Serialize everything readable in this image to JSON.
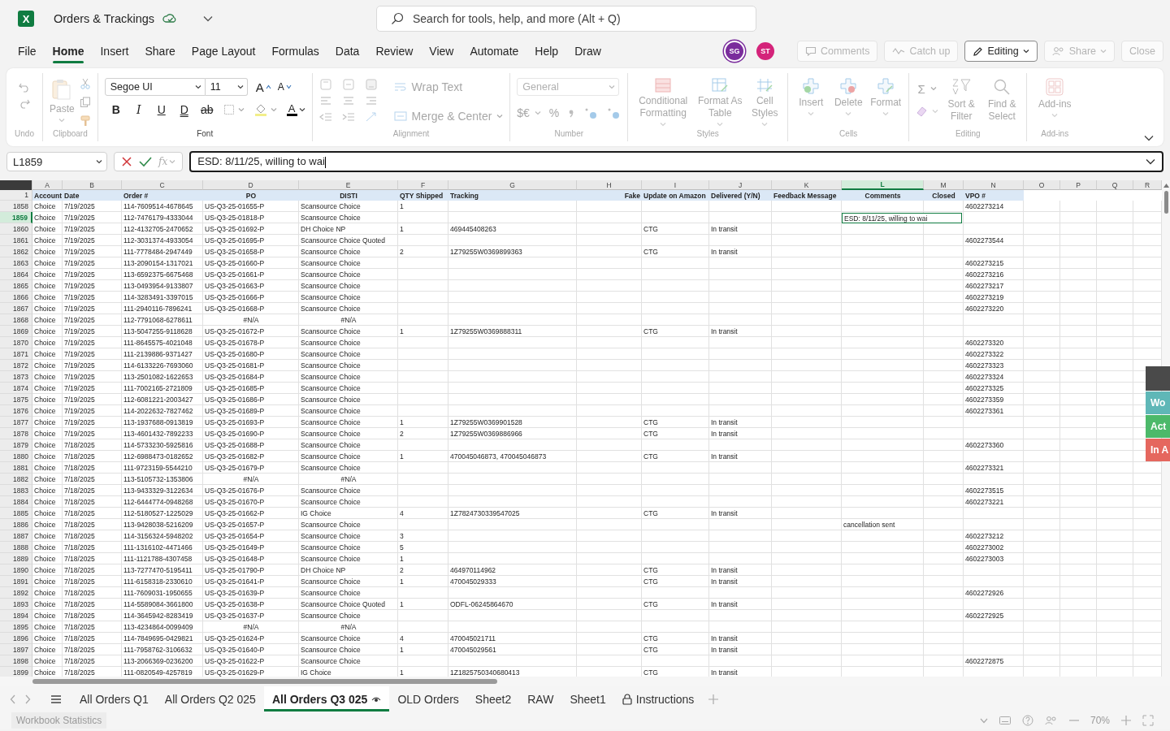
{
  "app_bar": {
    "logo_letter": "X",
    "title": "Orders & Trackings",
    "search": {
      "placeholder": "Search for tools, help, and more (Alt + Q)"
    }
  },
  "menu_tabs": [
    {
      "label": "File",
      "selected": false
    },
    {
      "label": "Home",
      "selected": true
    },
    {
      "label": "Insert",
      "selected": false
    },
    {
      "label": "Share",
      "selected": false
    },
    {
      "label": "Page Layout",
      "selected": false
    },
    {
      "label": "Formulas",
      "selected": false
    },
    {
      "label": "Data",
      "selected": false
    },
    {
      "label": "Review",
      "selected": false
    },
    {
      "label": "View",
      "selected": false
    },
    {
      "label": "Automate",
      "selected": false
    },
    {
      "label": "Help",
      "selected": false
    },
    {
      "label": "Draw",
      "selected": false
    }
  ],
  "avatars": [
    {
      "initials": "SG",
      "color": "#7a2c9c"
    },
    {
      "initials": "ST",
      "color": "#d4237a"
    }
  ],
  "header_buttons": [
    {
      "kind": "comments",
      "label": "Comments",
      "disabled": true
    },
    {
      "kind": "catchup",
      "label": "Catch up",
      "disabled": true
    },
    {
      "kind": "editing",
      "label": "Editing",
      "disabled": false
    },
    {
      "kind": "share",
      "label": "Share",
      "disabled": true
    },
    {
      "kind": "close",
      "label": "Close",
      "disabled": true
    }
  ],
  "ribbon": {
    "groups": [
      {
        "kind": "undo",
        "label": "Undo",
        "disabled": true
      },
      {
        "kind": "clipboard",
        "label": "Clipboard",
        "disabled": true,
        "paste_label": "Paste"
      },
      {
        "kind": "font",
        "label": "Font",
        "disabled": false,
        "font_name": "Segoe UI",
        "font_size": "11",
        "grow_label": "A",
        "shrink_label": "A",
        "style_buttons": [
          {
            "kind": "bold",
            "label": "B"
          },
          {
            "kind": "italic",
            "label": "I"
          },
          {
            "kind": "underline",
            "label": "U"
          },
          {
            "kind": "double",
            "label": "D"
          },
          {
            "kind": "strike",
            "label": "ab"
          }
        ],
        "font_color_label": "A"
      },
      {
        "kind": "alignment",
        "label": "Alignment",
        "disabled": true,
        "wrap_label": "Wrap Text",
        "merge_label": "Merge & Center"
      },
      {
        "kind": "number",
        "label": "Number",
        "disabled": true,
        "format": "General",
        "currency_label": "$€",
        "percent_label": "%"
      },
      {
        "kind": "styles",
        "label": "Styles",
        "disabled": true,
        "buttons": [
          "Conditional Formatting",
          "Format As Table",
          "Cell Styles"
        ]
      },
      {
        "kind": "cells",
        "label": "Cells",
        "disabled": true,
        "buttons": [
          "Insert",
          "Delete",
          "Format"
        ]
      },
      {
        "kind": "editing",
        "label": "Editing",
        "disabled": true,
        "sum_label": "Σ",
        "buttons": [
          "Sort & Filter",
          "Find & Select"
        ]
      },
      {
        "kind": "addins",
        "label": "Add-ins",
        "disabled": true,
        "buttons": [
          "Add-ins"
        ]
      }
    ]
  },
  "formula_bar": {
    "name_box": "L1859",
    "fx_label": "fx",
    "value": "ESD: 8/11/25, willing to wai"
  },
  "sheet": {
    "header_row_label": "1",
    "columns": [
      {
        "letter": "A",
        "heading": "Account",
        "selected": false
      },
      {
        "letter": "B",
        "heading": "Date",
        "selected": false
      },
      {
        "letter": "C",
        "heading": "Order #",
        "selected": false
      },
      {
        "letter": "D",
        "heading": "PO",
        "selected": false
      },
      {
        "letter": "E",
        "heading": "DISTI",
        "selected": false
      },
      {
        "letter": "F",
        "heading": "QTY Shipped",
        "selected": false
      },
      {
        "letter": "G",
        "heading": "Tracking",
        "selected": false
      },
      {
        "letter": "H",
        "heading": "Fake",
        "selected": false
      },
      {
        "letter": "I",
        "heading": "Update on Amazon",
        "selected": false
      },
      {
        "letter": "J",
        "heading": "Delivered (Y/N)",
        "selected": false
      },
      {
        "letter": "K",
        "heading": "Feedback Message",
        "selected": false
      },
      {
        "letter": "L",
        "heading": "Comments",
        "selected": true
      },
      {
        "letter": "M",
        "heading": "Closed",
        "selected": false
      },
      {
        "letter": "N",
        "heading": "VPO #",
        "selected": false
      },
      {
        "letter": "O",
        "selected": false
      },
      {
        "letter": "P",
        "selected": false
      },
      {
        "letter": "Q",
        "selected": false
      },
      {
        "letter": "R",
        "selected": false
      }
    ],
    "rows": [
      {
        "row": "1858",
        "selected": false,
        "account": "Choice",
        "date": "7/19/2025",
        "order": "114-7609514-4678645",
        "po": "US-Q3-25-01655-P",
        "disti": "Scansource Choice",
        "qty": "1",
        "vpo": "4602273214"
      },
      {
        "row": "1859",
        "selected": true,
        "account": "Choice",
        "date": "7/19/2025",
        "order": "112-7476179-4333044",
        "po": "US-Q3-25-01818-P",
        "disti": "Scansource Choice",
        "comments": "ESD: 8/11/25, willing to wai"
      },
      {
        "row": "1860",
        "selected": false,
        "account": "Choice",
        "date": "7/19/2025",
        "order": "112-4132705-2470652",
        "po": "US-Q3-25-01692-P",
        "disti": "DH Choice NP",
        "qty": "1",
        "tracking": "469445408263",
        "update": "CTG",
        "delivered": "In transit"
      },
      {
        "row": "1861",
        "selected": false,
        "account": "Choice",
        "date": "7/19/2025",
        "order": "112-3031374-4933054",
        "po": "US-Q3-25-01695-P",
        "disti": "Scansource Choice Quoted",
        "vpo": "4602273544"
      },
      {
        "row": "1862",
        "selected": false,
        "account": "Choice",
        "date": "7/19/2025",
        "order": "111-7778484-2947449",
        "po": "US-Q3-25-01658-P",
        "disti": "Scansource Choice",
        "qty": "2",
        "tracking": "1Z79255W0369899363",
        "update": "CTG",
        "delivered": "In transit"
      },
      {
        "row": "1863",
        "selected": false,
        "account": "Choice",
        "date": "7/19/2025",
        "order": "113-2090154-1317021",
        "po": "US-Q3-25-01660-P",
        "disti": "Scansource Choice",
        "vpo": "4602273215"
      },
      {
        "row": "1864",
        "selected": false,
        "account": "Choice",
        "date": "7/19/2025",
        "order": "113-6592375-6675468",
        "po": "US-Q3-25-01661-P",
        "disti": "Scansource Choice",
        "vpo": "4602273216"
      },
      {
        "row": "1865",
        "selected": false,
        "account": "Choice",
        "date": "7/19/2025",
        "order": "113-0493954-9133807",
        "po": "US-Q3-25-01663-P",
        "disti": "Scansource Choice",
        "vpo": "4602273217"
      },
      {
        "row": "1866",
        "selected": false,
        "account": "Choice",
        "date": "7/19/2025",
        "order": "114-3283491-3397015",
        "po": "US-Q3-25-01666-P",
        "disti": "Scansource Choice",
        "vpo": "4602273219"
      },
      {
        "row": "1867",
        "selected": false,
        "account": "Choice",
        "date": "7/19/2025",
        "order": "111-2940116-7896241",
        "po": "US-Q3-25-01668-P",
        "disti": "Scansource Choice",
        "vpo": "4602273220"
      },
      {
        "row": "1868",
        "selected": false,
        "account": "Choice",
        "date": "7/19/2025",
        "order": "112-7791068-6278611",
        "po": "#N/A",
        "disti": "#N/A"
      },
      {
        "row": "1869",
        "selected": false,
        "account": "Choice",
        "date": "7/19/2025",
        "order": "113-5047255-9118628",
        "po": "US-Q3-25-01672-P",
        "disti": "Scansource Choice",
        "qty": "1",
        "tracking": "1Z79255W0369888311",
        "update": "CTG",
        "delivered": "In transit"
      },
      {
        "row": "1870",
        "selected": false,
        "account": "Choice",
        "date": "7/19/2025",
        "order": "111-8645575-4021048",
        "po": "US-Q3-25-01678-P",
        "disti": "Scansource Choice",
        "vpo": "4602273320"
      },
      {
        "row": "1871",
        "selected": false,
        "account": "Choice",
        "date": "7/19/2025",
        "order": "111-2139886-9371427",
        "po": "US-Q3-25-01680-P",
        "disti": "Scansource Choice",
        "vpo": "4602273322"
      },
      {
        "row": "1872",
        "selected": false,
        "account": "Choice",
        "date": "7/19/2025",
        "order": "114-6133226-7693060",
        "po": "US-Q3-25-01681-P",
        "disti": "Scansource Choice",
        "vpo": "4602273323"
      },
      {
        "row": "1873",
        "selected": false,
        "account": "Choice",
        "date": "7/19/2025",
        "order": "113-2501082-1622653",
        "po": "US-Q3-25-01684-P",
        "disti": "Scansource Choice",
        "vpo": "4602273324"
      },
      {
        "row": "1874",
        "selected": false,
        "account": "Choice",
        "date": "7/19/2025",
        "order": "111-7002165-2721809",
        "po": "US-Q3-25-01685-P",
        "disti": "Scansource Choice",
        "vpo": "4602273325"
      },
      {
        "row": "1875",
        "selected": false,
        "account": "Choice",
        "date": "7/19/2025",
        "order": "112-6081221-2003427",
        "po": "US-Q3-25-01686-P",
        "disti": "Scansource Choice",
        "vpo": "4602273359"
      },
      {
        "row": "1876",
        "selected": false,
        "account": "Choice",
        "date": "7/19/2025",
        "order": "114-2022632-7827462",
        "po": "US-Q3-25-01689-P",
        "disti": "Scansource Choice",
        "vpo": "4602273361"
      },
      {
        "row": "1877",
        "selected": false,
        "account": "Choice",
        "date": "7/19/2025",
        "order": "113-1937688-0913819",
        "po": "US-Q3-25-01693-P",
        "disti": "Scansource Choice",
        "qty": "1",
        "tracking": "1Z79255W0369901528",
        "update": "CTG",
        "delivered": "In transit"
      },
      {
        "row": "1878",
        "selected": false,
        "account": "Choice",
        "date": "7/19/2025",
        "order": "113-4601432-7892233",
        "po": "US-Q3-25-01690-P",
        "disti": "Scansource Choice",
        "qty": "2",
        "tracking": "1Z79255W0369886966",
        "update": "CTG",
        "delivered": "In transit"
      },
      {
        "row": "1879",
        "selected": false,
        "account": "Choice",
        "date": "7/18/2025",
        "order": "114-5733230-5925816",
        "po": "US-Q3-25-01688-P",
        "disti": "Scansource Choice",
        "vpo": "4602273360"
      },
      {
        "row": "1880",
        "selected": false,
        "account": "Choice",
        "date": "7/18/2025",
        "order": "112-6988473-0182652",
        "po": "US-Q3-25-01682-P",
        "disti": "Scansource Choice",
        "qty": "1",
        "tracking": "470045046873, 470045046873",
        "update": "CTG",
        "delivered": "In transit"
      },
      {
        "row": "1881",
        "selected": false,
        "account": "Choice",
        "date": "7/18/2025",
        "order": "111-9723159-5544210",
        "po": "US-Q3-25-01679-P",
        "disti": "Scansource Choice",
        "vpo": "4602273321"
      },
      {
        "row": "1882",
        "selected": false,
        "account": "Choice",
        "date": "7/18/2025",
        "order": "113-5105732-1353806",
        "po": "#N/A",
        "disti": "#N/A"
      },
      {
        "row": "1883",
        "selected": false,
        "account": "Choice",
        "date": "7/18/2025",
        "order": "113-9433329-3122634",
        "po": "US-Q3-25-01676-P",
        "disti": "Scansource Choice",
        "vpo": "4602273515"
      },
      {
        "row": "1884",
        "selected": false,
        "account": "Choice",
        "date": "7/18/2025",
        "order": "112-6444774-0948268",
        "po": "US-Q3-25-01670-P",
        "disti": "Scansource Choice",
        "vpo": "4602273221"
      },
      {
        "row": "1885",
        "selected": false,
        "account": "Choice",
        "date": "7/18/2025",
        "order": "112-5180527-1225029",
        "po": "US-Q3-25-01662-P",
        "disti": "IG Choice",
        "qty": "4",
        "tracking": "1Z7824730339547025",
        "update": "CTG",
        "delivered": "In transit"
      },
      {
        "row": "1886",
        "selected": false,
        "account": "Choice",
        "date": "7/18/2025",
        "order": "113-9428038-5216209",
        "po": "US-Q3-25-01657-P",
        "disti": "Scansource Choice",
        "comments": "cancellation sent"
      },
      {
        "row": "1887",
        "selected": false,
        "account": "Choice",
        "date": "7/18/2025",
        "order": "114-3156324-5948202",
        "po": "US-Q3-25-01654-P",
        "disti": "Scansource Choice",
        "qty": "3",
        "vpo": "4602273212"
      },
      {
        "row": "1888",
        "selected": false,
        "account": "Choice",
        "date": "7/18/2025",
        "order": "111-1316102-4471466",
        "po": "US-Q3-25-01649-P",
        "disti": "Scansource Choice",
        "qty": "5",
        "vpo": "4602273002"
      },
      {
        "row": "1889",
        "selected": false,
        "account": "Choice",
        "date": "7/18/2025",
        "order": "111-1121788-4307458",
        "po": "US-Q3-25-01648-P",
        "disti": "Scansource Choice",
        "qty": "1",
        "vpo": "4602273003"
      },
      {
        "row": "1890",
        "selected": false,
        "account": "Choice",
        "date": "7/18/2025",
        "order": "113-7277470-5195411",
        "po": "US-Q3-25-01790-P",
        "disti": "DH Choice NP",
        "qty": "2",
        "tracking": "464970114962",
        "update": "CTG",
        "delivered": "In transit"
      },
      {
        "row": "1891",
        "selected": false,
        "account": "Choice",
        "date": "7/18/2025",
        "order": "111-6158318-2330610",
        "po": "US-Q3-25-01641-P",
        "disti": "Scansource Choice",
        "qty": "1",
        "tracking": "470045029333",
        "update": "CTG",
        "delivered": "In transit"
      },
      {
        "row": "1892",
        "selected": false,
        "account": "Choice",
        "date": "7/18/2025",
        "order": "111-7609031-1950655",
        "po": "US-Q3-25-01639-P",
        "disti": "Scansource Choice",
        "vpo": "4602272926"
      },
      {
        "row": "1893",
        "selected": false,
        "account": "Choice",
        "date": "7/18/2025",
        "order": "114-5589084-3661800",
        "po": "US-Q3-25-01638-P",
        "disti": "Scansource Choice Quoted",
        "qty": "1",
        "tracking": "ODFL-06245864670",
        "update": "CTG",
        "delivered": "In transit"
      },
      {
        "row": "1894",
        "selected": false,
        "account": "Choice",
        "date": "7/18/2025",
        "order": "114-3645942-8283419",
        "po": "US-Q3-25-01637-P",
        "disti": "Scansource Choice",
        "vpo": "4602272925"
      },
      {
        "row": "1895",
        "selected": false,
        "account": "Choice",
        "date": "7/18/2025",
        "order": "113-4234864-0099409",
        "po": "#N/A",
        "disti": "#N/A"
      },
      {
        "row": "1896",
        "selected": false,
        "account": "Choice",
        "date": "7/18/2025",
        "order": "114-7849695-0429821",
        "po": "US-Q3-25-01624-P",
        "disti": "Scansource Choice",
        "qty": "4",
        "tracking": "470045021711",
        "update": "CTG",
        "delivered": "In transit"
      },
      {
        "row": "1897",
        "selected": false,
        "account": "Choice",
        "date": "7/18/2025",
        "order": "111-7958762-3106632",
        "po": "US-Q3-25-01640-P",
        "disti": "Scansource Choice",
        "qty": "1",
        "tracking": "470045029561",
        "update": "CTG",
        "delivered": "In transit"
      },
      {
        "row": "1898",
        "selected": false,
        "account": "Choice",
        "date": "7/18/2025",
        "order": "113-2066369-0236200",
        "po": "US-Q3-25-01622-P",
        "disti": "Scansource Choice",
        "vpo": "4602272875"
      },
      {
        "row": "1899",
        "selected": false,
        "account": "Choice",
        "date": "7/18/2025",
        "order": "111-0820549-4257819",
        "po": "US-Q3-25-01629-P",
        "disti": "IG Choice",
        "qty": "1",
        "tracking": "1Z1825750340680413",
        "update": "CTG",
        "delivered": "In transit"
      }
    ]
  },
  "side_panel": [
    {
      "label": "Wo",
      "color": "#5fb7b7"
    },
    {
      "label": "Act",
      "color": "#4cb96a"
    },
    {
      "label": "In A",
      "color": "#e5675e"
    }
  ],
  "sheet_tabs": [
    {
      "label": "All Orders Q1",
      "selected": false,
      "kind": "plain"
    },
    {
      "label": "All Orders Q2 025",
      "selected": false,
      "kind": "plain"
    },
    {
      "label": "All Orders Q3 025",
      "selected": true,
      "kind": "watched"
    },
    {
      "label": "OLD Orders",
      "selected": false,
      "kind": "plain"
    },
    {
      "label": "Sheet2",
      "selected": false,
      "kind": "plain"
    },
    {
      "label": "RAW",
      "selected": false,
      "kind": "plain"
    },
    {
      "label": "Sheet1",
      "selected": false,
      "kind": "plain"
    },
    {
      "label": "Instructions",
      "selected": false,
      "kind": "locked"
    }
  ],
  "status_bar": {
    "statistics": "Workbook Statistics",
    "zoom": "70%"
  }
}
